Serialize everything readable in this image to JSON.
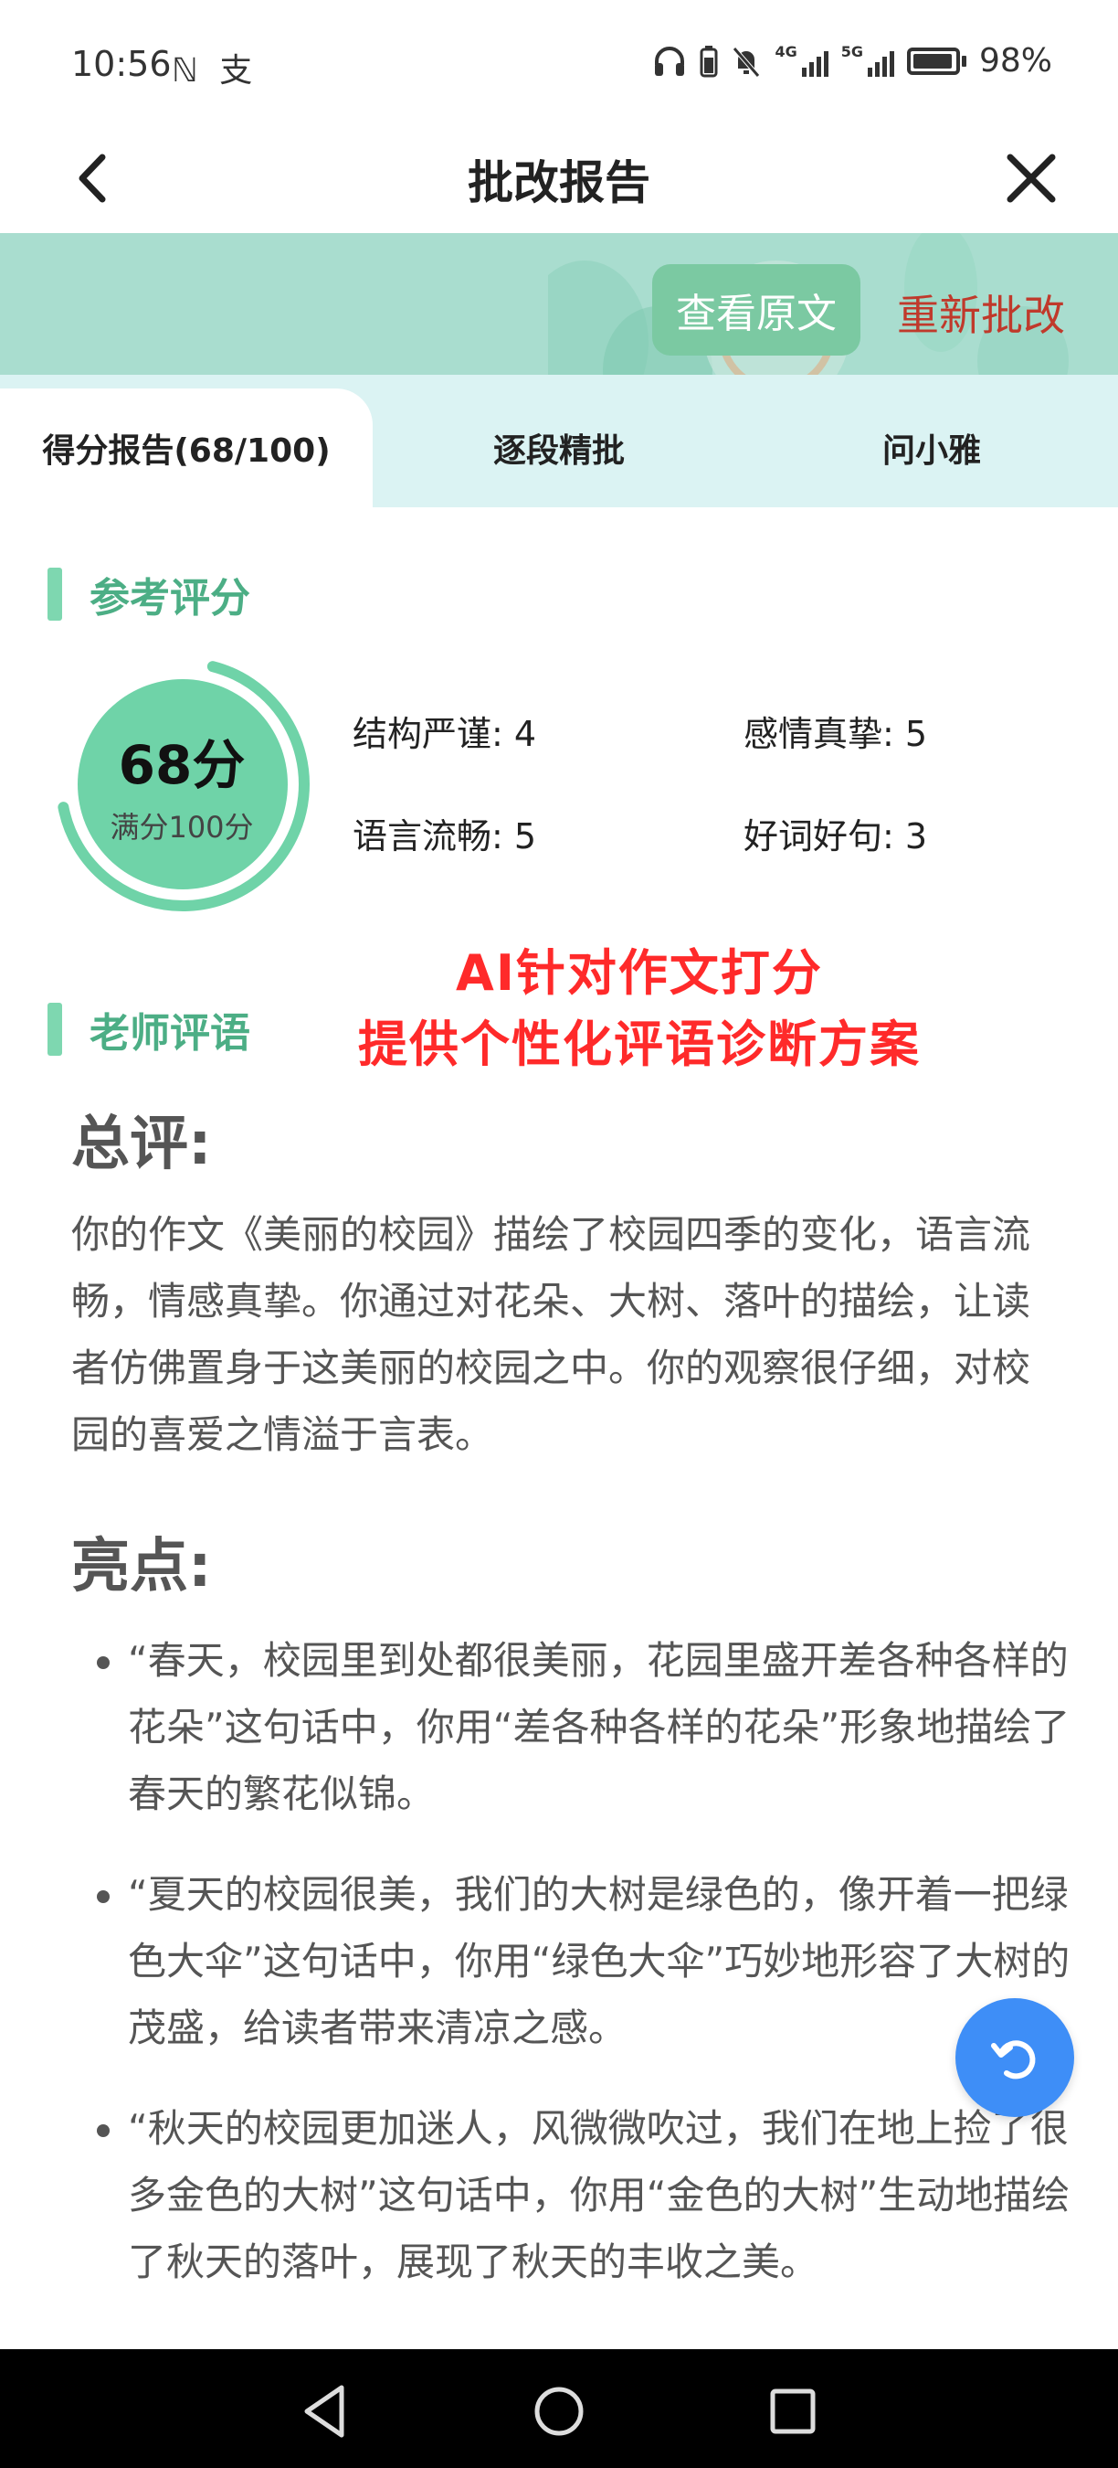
{
  "status_bar": {
    "time": "10:56",
    "left_icons": "ℕ 支",
    "network_1": "4G",
    "network_2": "5G",
    "battery": "98%"
  },
  "nav": {
    "title": "批改报告",
    "back_icon": "chevron-left-icon",
    "close_icon": "close-icon"
  },
  "banner": {
    "view_original": "查看原文",
    "regrade": "重新批改"
  },
  "tabs": [
    {
      "label": "得分报告(68/100)",
      "active": true
    },
    {
      "label": "逐段精批",
      "active": false
    },
    {
      "label": "问小雅",
      "active": false
    }
  ],
  "score_section": {
    "title": "参考评分",
    "score": "68分",
    "total": "满分100分",
    "score_fraction": 0.68,
    "metrics": [
      {
        "label": "结构严谨: 4"
      },
      {
        "label": "感情真挚: 5"
      },
      {
        "label": "语言流畅: 5"
      },
      {
        "label": "好词好句: 3"
      }
    ]
  },
  "promo": {
    "line1": "AI针对作文打分",
    "line2": "提供个性化评语诊断方案"
  },
  "comment_section": {
    "title": "老师评语",
    "summary_heading": "总评:",
    "summary_text": "你的作文《美丽的校园》描绘了校园四季的变化，语言流畅，情感真挚。你通过对花朵、大树、落叶的描绘，让读者仿佛置身于这美丽的校园之中。你的观察很仔细，对校园的喜爱之情溢于言表。",
    "highlights_heading": "亮点:",
    "highlights": [
      "“春天，校园里到处都很美丽，花园里盛开差各种各样的花朵”这句话中，你用“差各种各样的花朵”形象地描绘了春天的繁花似锦。",
      "“夏天的校园很美，我们的大树是绿色的，像开着一把绿色大伞”这句话中，你用“绿色大伞”巧妙地形容了大树的茂盛，给读者带来清凉之感。",
      "“秋天的校园更加迷人，风微微吹过，我们在地上捡了很多金色的大树”这句话中，你用“金色的大树”生动地描绘了秋天的落叶，展现了秋天的丰收之美。"
    ]
  },
  "colors": {
    "accent_green": "#4cae85",
    "ring_green": "#6fd3a8",
    "banner_bg": "#a9ddcf",
    "tab_bg": "#dbf3f3",
    "regrade_red": "#c0392b",
    "promo_red": "#ff2a2a",
    "fab_blue": "#3e8ef7"
  }
}
